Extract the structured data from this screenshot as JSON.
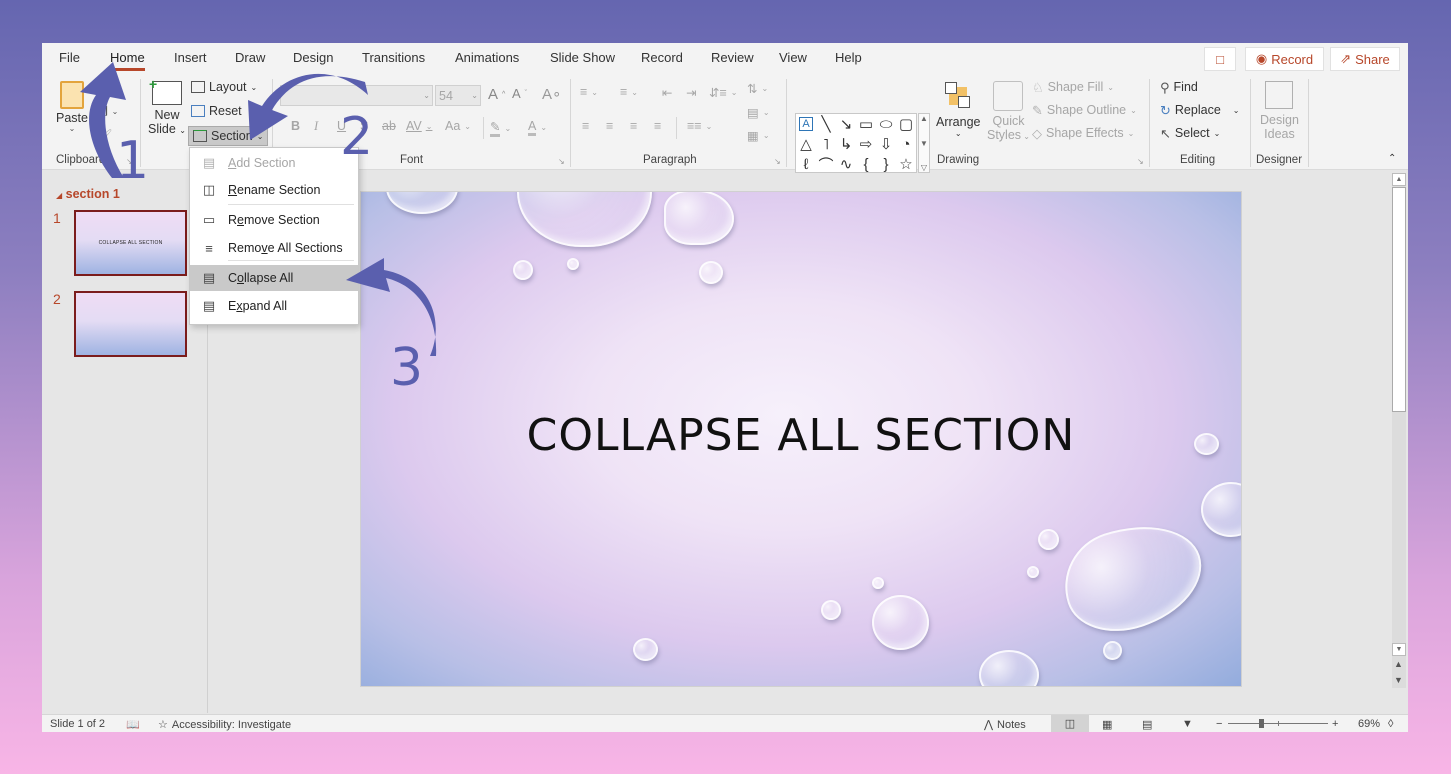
{
  "ribbon_tabs": [
    "File",
    "Home",
    "Insert",
    "Draw",
    "Design",
    "Transitions",
    "Animations",
    "Slide Show",
    "Record",
    "Review",
    "View",
    "Help"
  ],
  "active_tab": "Home",
  "top_right": {
    "comments_icon": "comment-icon",
    "record_label": "Record",
    "share_label": "Share"
  },
  "clipboard": {
    "paste_label": "Paste",
    "group_label": "Clipboard"
  },
  "slides": {
    "new_slide_line1": "New",
    "new_slide_line2": "Slide",
    "layout_label": "Layout",
    "reset_label": "Reset",
    "section_label": "Section"
  },
  "font": {
    "font_name": "",
    "font_size": "54",
    "bold": "B",
    "italic": "I",
    "underline": "U",
    "shadow": "S",
    "strikethrough": "ab",
    "spacing": "AV",
    "change_case": "Aa",
    "group_label": "Font"
  },
  "paragraph": {
    "group_label": "Paragraph"
  },
  "drawing": {
    "arrange_label": "Arrange",
    "quick_styles_line1": "Quick",
    "quick_styles_line2": "Styles",
    "shape_fill": "Shape Fill",
    "shape_outline": "Shape Outline",
    "shape_effects": "Shape Effects",
    "group_label": "Drawing",
    "shapes": [
      "A",
      "╲",
      "↘",
      "▭",
      "⬭",
      "▢",
      "△",
      "˥",
      "↳",
      "⇨",
      "⇩",
      "◔",
      "ℓ",
      "⌒",
      "∿",
      "{",
      "}",
      "☆"
    ]
  },
  "editing": {
    "find_label": "Find",
    "replace_label": "Replace",
    "select_label": "Select",
    "group_label": "Editing"
  },
  "designer": {
    "design_ideas_line1": "Design",
    "design_ideas_line2": "Ideas",
    "group_label": "Designer"
  },
  "section_menu": {
    "items": [
      {
        "label": "Add Section",
        "accel": "A",
        "disabled": true
      },
      {
        "label": "Rename Section",
        "accel": "R",
        "disabled": false
      },
      {
        "label": "Remove Section",
        "accel": "e",
        "disabled": false
      },
      {
        "label": "Remove All Sections",
        "accel": "v",
        "disabled": false
      },
      {
        "label": "Collapse All",
        "accel": "o",
        "disabled": false,
        "highlighted": true
      },
      {
        "label": "Expand All",
        "accel": "x",
        "disabled": false
      }
    ]
  },
  "thumbnail_pane": {
    "section_name": "section 1",
    "slides": [
      {
        "number": "1",
        "title": "COLLAPSE ALL SECTION"
      },
      {
        "number": "2",
        "title": ""
      }
    ]
  },
  "slide": {
    "title": "COLLAPSE ALL SECTION"
  },
  "annotations": [
    "1",
    "2",
    "3"
  ],
  "status_bar": {
    "slide_position": "Slide 1 of 2",
    "accessibility": "Accessibility: Investigate",
    "notes_label": "Notes",
    "zoom_percent": "69%",
    "zoom_level": 0.69
  },
  "colors": {
    "accent": "#b7472a",
    "annotation_arrow": "#5a5fae",
    "menu_highlight": "#c9c9c9",
    "thumb_border": "#7b1c1c"
  }
}
